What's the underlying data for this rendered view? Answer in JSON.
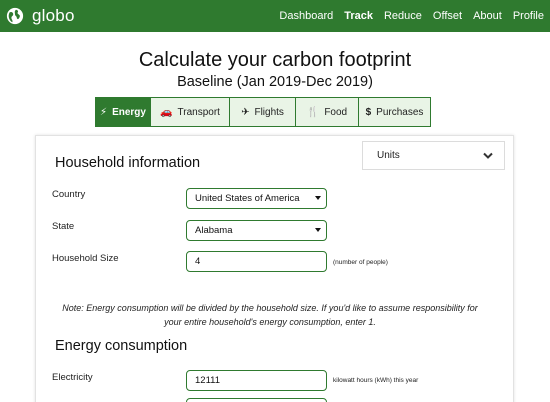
{
  "nav": {
    "brand": "globo",
    "links": [
      "Dashboard",
      "Track",
      "Reduce",
      "Offset",
      "About",
      "Profile"
    ],
    "active": "Track"
  },
  "header": {
    "title": "Calculate your carbon footprint",
    "subtitle": "Baseline (Jan 2019-Dec 2019)"
  },
  "tabs": [
    {
      "label": "Energy",
      "icon": "lightning-icon",
      "active": true
    },
    {
      "label": "Transport",
      "icon": "car-icon",
      "active": false
    },
    {
      "label": "Flights",
      "icon": "plane-icon",
      "active": false
    },
    {
      "label": "Food",
      "icon": "utensils-icon",
      "active": false
    },
    {
      "label": "Purchases",
      "icon": "dollar-icon",
      "active": false
    }
  ],
  "units": {
    "label": "Units"
  },
  "household": {
    "title": "Household information",
    "country_label": "Country",
    "country_value": "United States of America",
    "state_label": "State",
    "state_value": "Alabama",
    "size_label": "Household Size",
    "size_value": "4",
    "size_hint": "(number of people)"
  },
  "note": "Note: Energy consumption will be divided by the household size. If you'd like to assume responsibility for your entire household's energy consumption, enter 1.",
  "energy": {
    "title": "Energy consumption",
    "electricity_label": "Electricity",
    "electricity_value": "12111",
    "electricity_hint": "kilowatt hours (kWh) this year"
  },
  "colors": {
    "brand_green": "#2f7a2f",
    "tab_bg": "#e9f4e6"
  }
}
